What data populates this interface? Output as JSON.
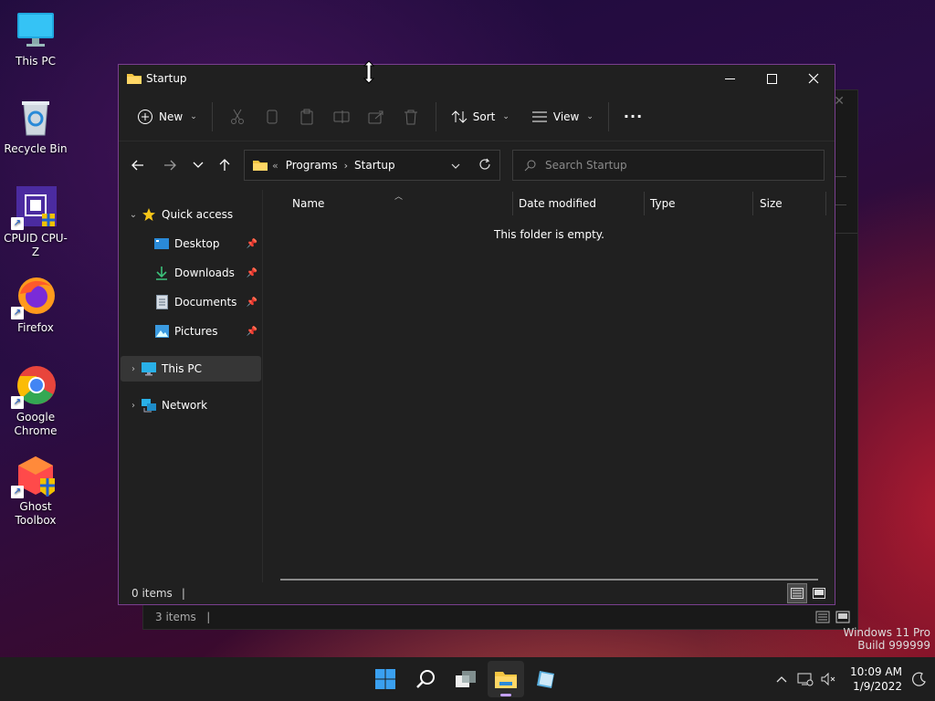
{
  "desktop": {
    "icons": [
      {
        "label": "This PC"
      },
      {
        "label": "Recycle Bin"
      },
      {
        "label": "CPUID CPU-Z"
      },
      {
        "label": "Firefox"
      },
      {
        "label": "Google Chrome"
      },
      {
        "label": "Ghost Toolbox"
      }
    ],
    "watermark_line1": "Windows 11 Pro",
    "watermark_line2": "Build 999999"
  },
  "background_window": {
    "status": "3 items"
  },
  "window": {
    "title": "Startup",
    "controls": {
      "minimize": "—",
      "maximize": "☐",
      "close": "✕"
    },
    "toolbar": {
      "new_label": "New",
      "sort_label": "Sort",
      "view_label": "View",
      "more_label": "···"
    },
    "address": {
      "overflow": "«",
      "crumbs": [
        "Programs",
        "Startup"
      ]
    },
    "search": {
      "placeholder": "Search Startup"
    },
    "sidebar": {
      "quick_access": "Quick access",
      "items": [
        {
          "label": "Desktop"
        },
        {
          "label": "Downloads"
        },
        {
          "label": "Documents"
        },
        {
          "label": "Pictures"
        }
      ],
      "this_pc": "This PC",
      "network": "Network"
    },
    "columns": [
      "Name",
      "Date modified",
      "Type",
      "Size"
    ],
    "empty_message": "This folder is empty.",
    "status": "0 items"
  },
  "taskbar": {
    "time": "10:09 AM",
    "date": "1/9/2022"
  },
  "colors": {
    "accent": "#7a3f8f",
    "window_bg": "#202020",
    "taskbar_bg": "#1e1e1e"
  }
}
